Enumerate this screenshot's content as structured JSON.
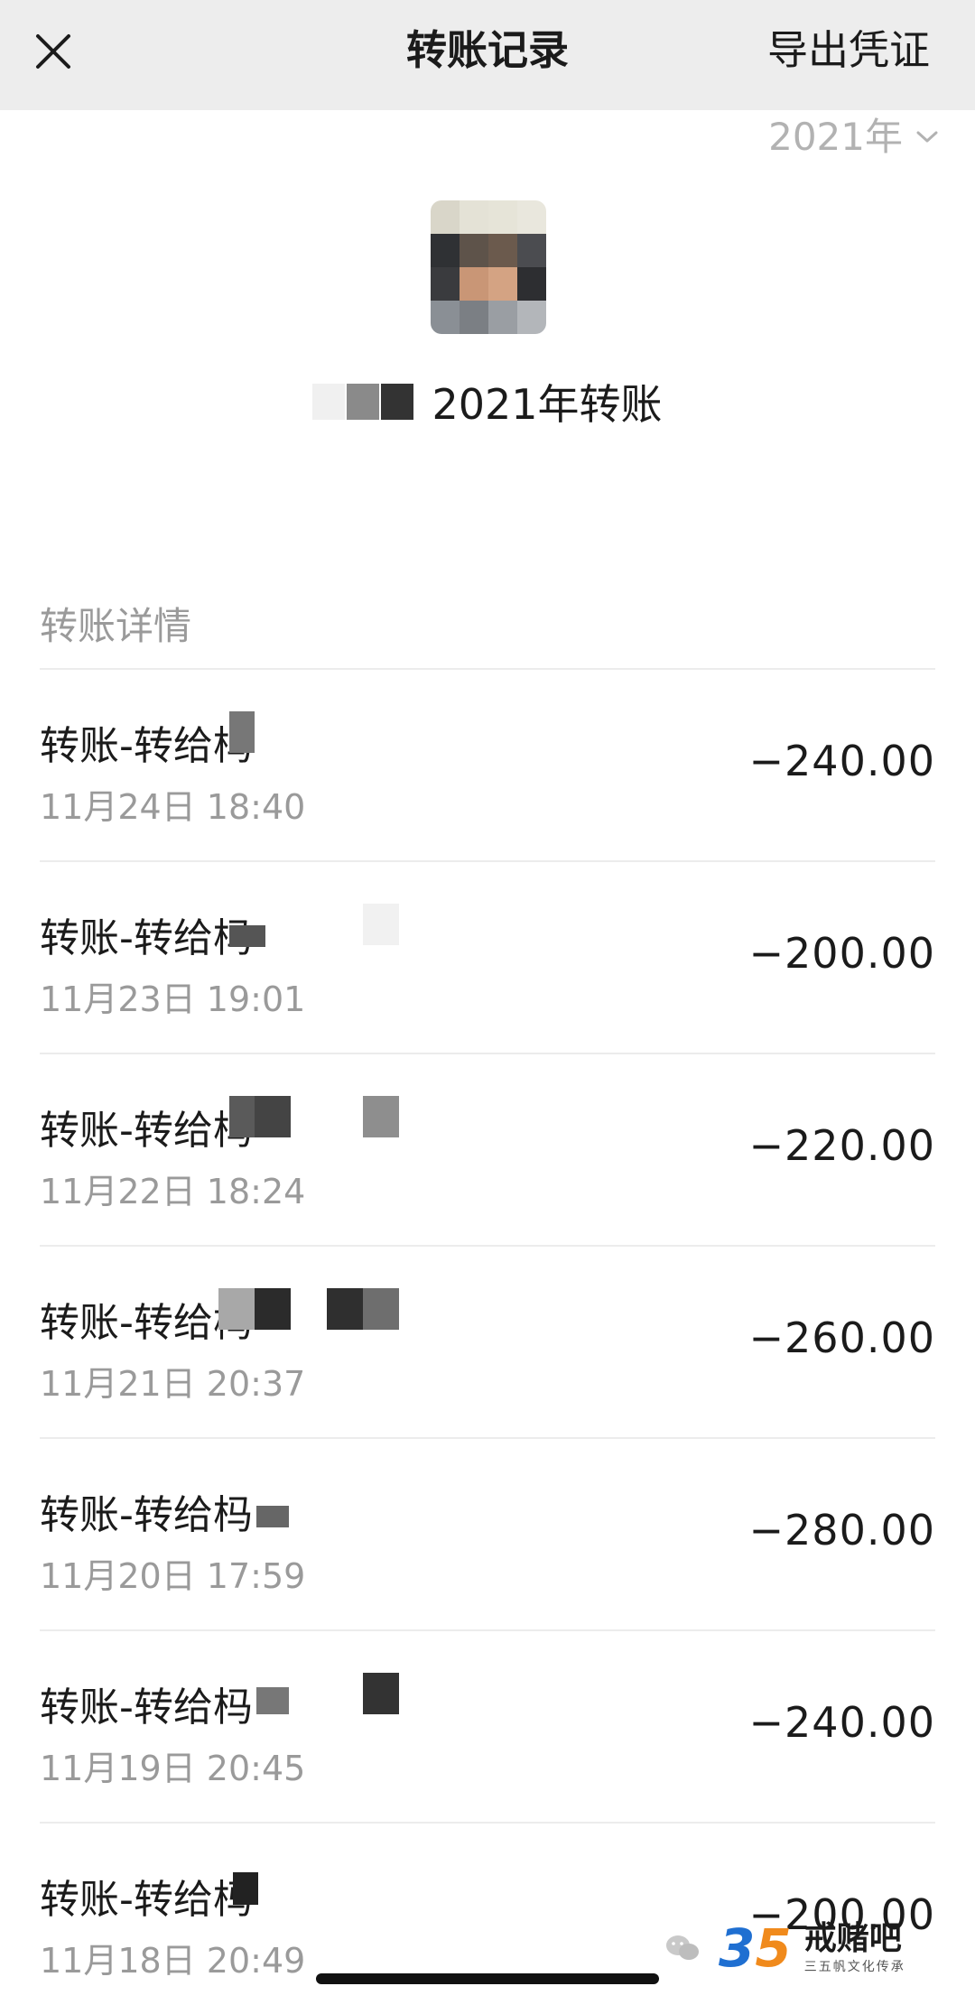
{
  "header": {
    "title": "转账记录",
    "export_label": "导出凭证"
  },
  "year_filter": {
    "value": "2021年"
  },
  "summary": {
    "text": "2021年转账"
  },
  "section": {
    "title": "转账详情"
  },
  "transactions": [
    {
      "title": "转账-转给杩",
      "time": "11月24日 18:40",
      "amount": "−240.00"
    },
    {
      "title": "转账-转给杩",
      "time": "11月23日 19:01",
      "amount": "−200.00"
    },
    {
      "title": "转账-转给杩",
      "time": "11月22日 18:24",
      "amount": "−220.00"
    },
    {
      "title": "转账-转给杩",
      "time": "11月21日 20:37",
      "amount": "−260.00"
    },
    {
      "title": "转账-转给杩",
      "time": "11月20日 17:59",
      "amount": "−280.00"
    },
    {
      "title": "转账-转给杩",
      "time": "11月19日 20:45",
      "amount": "−240.00"
    },
    {
      "title": "转账-转给杩",
      "time": "11月18日 20:49",
      "amount": "−200.00"
    }
  ],
  "watermark": {
    "logo_3": "3",
    "logo_5": "5",
    "brand": "戒赌吧",
    "sub": "三五帆文化传承"
  },
  "icons": {
    "close": "close-icon",
    "chevron": "chevron-down-icon",
    "wechat": "wechat-icon"
  }
}
